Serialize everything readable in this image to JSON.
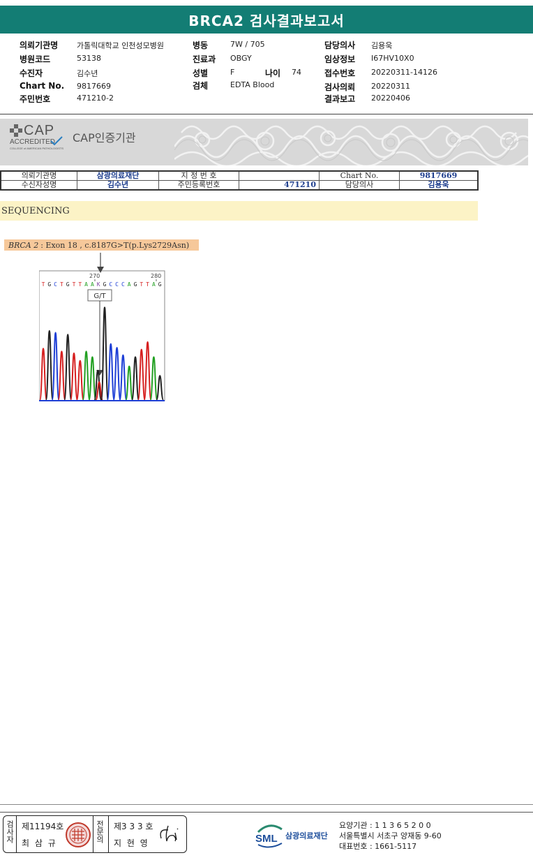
{
  "title": "BRCA2 검사결과보고서",
  "header": {
    "col1": [
      {
        "label": "의뢰기관명",
        "value": "가톨릭대학교 인천성모병원"
      },
      {
        "label": "병원코드",
        "value": "53138"
      },
      {
        "label": "수진자",
        "value": "김수년"
      },
      {
        "label": "Chart No.",
        "value": "9817669"
      },
      {
        "label": "주민번호",
        "value": "471210-2"
      }
    ],
    "col2": [
      {
        "label": "병동",
        "value": "7W / 705"
      },
      {
        "label": "진료과",
        "value": "OBGY"
      },
      {
        "label": "성별",
        "value": "F"
      },
      {
        "label": "검체",
        "value": "EDTA Blood"
      }
    ],
    "age": {
      "label": "나이",
      "value": "74"
    },
    "col3": [
      {
        "label": "담당의사",
        "value": "김용욱"
      },
      {
        "label": "임상정보",
        "value": "I67HV10X0"
      },
      {
        "label": "접수번호",
        "value": "20220311-14126"
      },
      {
        "label": "검사의뢰",
        "value": "20220311"
      },
      {
        "label": "결과보고",
        "value": "20220406"
      }
    ]
  },
  "cap": {
    "logo_main": "CAP",
    "logo_sub": "ACCREDITED",
    "logo_small": "COLLEGE of AMERICAN PATHOLOGISTS",
    "label": "CAP인증기관"
  },
  "table": {
    "r1": {
      "l1": "의뢰기관명",
      "v1": "삼광의료재단",
      "l2": "지 정 번 호",
      "v2": "",
      "l3": "Chart No.",
      "v3": "9817669"
    },
    "r2": {
      "l1": "수신자성명",
      "v1": "김수년",
      "l2": "주민등록번호",
      "v2": "471210",
      "l3": "담당의사",
      "v3": "김용욱"
    }
  },
  "section_title": "SEQUENCING",
  "mutation": {
    "gene": "BRCA 2",
    "detail": ": Exon 18 , c.8187G>T(p.Lys2729Asn)"
  },
  "chromatogram": {
    "pos_left": "270",
    "pos_right": "280",
    "bases": [
      "T",
      "G",
      "C",
      "T",
      "G",
      "T",
      "T",
      "A",
      "A",
      "K",
      "G",
      "C",
      "C",
      "C",
      "A",
      "G",
      "T",
      "T",
      "A",
      "G"
    ],
    "call": "G/T",
    "colors": {
      "A": "#22a022",
      "C": "#1e3fd6",
      "G": "#222222",
      "T": "#d62020",
      "K": "#7a3fa0"
    }
  },
  "footer": {
    "sign1_vertical": "검사자",
    "sign1_no": "제11194호",
    "sign1_name": "최 삼 규",
    "sign2_vertical": "전문의",
    "sign2_no": "제3 3 3 호",
    "sign2_name": "지 현 영",
    "org_abbr": "SML",
    "org_name": "삼광의료재단",
    "org_lines": [
      "요양기관 : 1 1 3 6 5 2 0 0",
      "서울특별시 서초구 양재동 9-60",
      "대표번호 : 1661-5117"
    ]
  }
}
